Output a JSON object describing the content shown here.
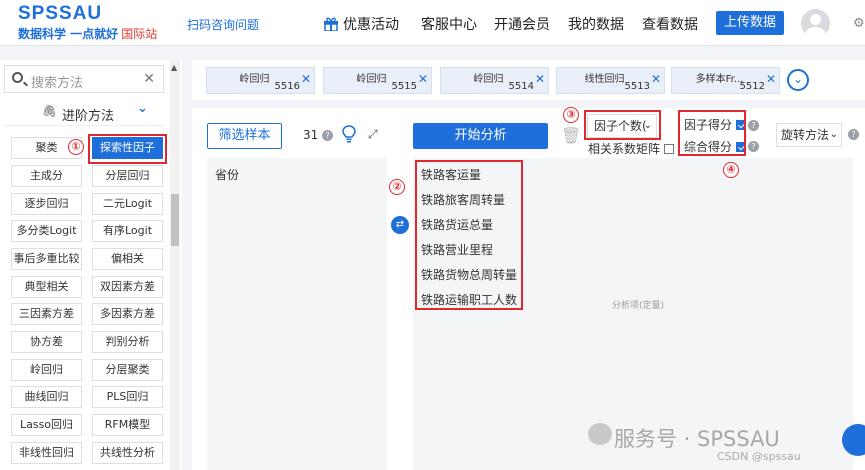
{
  "header": {
    "logo": "SPSSAU",
    "slogan": "数据科学 一点就好",
    "intl": "国际站",
    "scan_link": "扫码咨询问题",
    "nav": [
      "优惠活动",
      "客服中心",
      "开通会员",
      "我的数据",
      "查看数据"
    ],
    "upload": "上传数据"
  },
  "sidebar": {
    "search_placeholder": "搜索方法",
    "advanced": "进阶方法",
    "methods": [
      [
        "聚类",
        "探索性因子"
      ],
      [
        "主成分",
        "分层回归"
      ],
      [
        "逐步回归",
        "二元Logit"
      ],
      [
        "多分类Logit",
        "有序Logit"
      ],
      [
        "事后多重比较",
        "偏相关"
      ],
      [
        "典型相关",
        "双因素方差"
      ],
      [
        "三因素方差",
        "多因素方差"
      ],
      [
        "协方差",
        "判别分析"
      ],
      [
        "岭回归",
        "分层聚类"
      ],
      [
        "曲线回归",
        "PLS回归"
      ],
      [
        "Lasso回归",
        "RFM模型"
      ],
      [
        "非线性回归",
        "共线性分析"
      ]
    ],
    "active_method": "探索性因子"
  },
  "tabs": [
    {
      "name": "岭回归",
      "num": "5516"
    },
    {
      "name": "岭回归",
      "num": "5515"
    },
    {
      "name": "岭回归",
      "num": "5514"
    },
    {
      "name": "线性回归",
      "num": "5513"
    },
    {
      "name": "多样本Fr...",
      "num": "5512"
    }
  ],
  "main": {
    "filter_button": "筛选样本",
    "count": "31",
    "analyze_button": "开始分析",
    "variables": [
      "省份"
    ],
    "fields": [
      "铁路客运量",
      "铁路旅客周转量",
      "铁路货运总量",
      "铁路营业里程",
      "铁路货物总周转量",
      "铁路运输职工人数"
    ],
    "placeholder_hint": "分析项(定量)",
    "factor_count": "因子个数(",
    "corr_matrix": "相关系数矩阵",
    "factor_score": "因子得分",
    "composite_score": "综合得分",
    "rotation": "旋转方法"
  },
  "annotations": [
    "①",
    "②",
    "③",
    "④"
  ],
  "watermark": {
    "text": "服务号 · SPSSAU",
    "csdn": "CSDN @spssau"
  },
  "colors": {
    "brand": "#1e6fd9",
    "highlight": "#e0282e"
  }
}
